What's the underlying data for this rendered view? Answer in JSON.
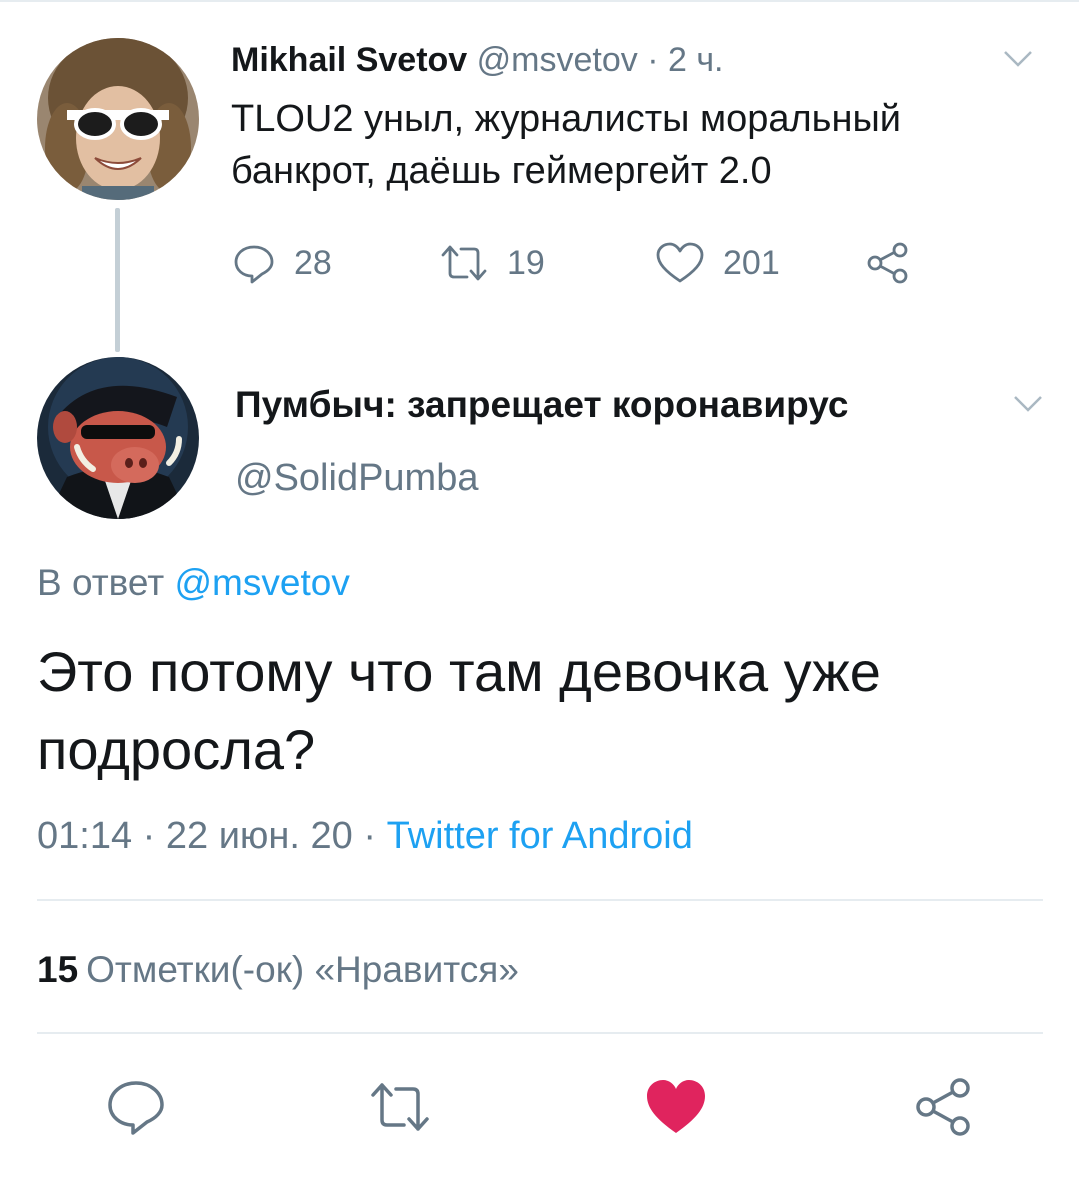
{
  "parent_tweet": {
    "name": "Mikhail Svetov",
    "handle": "@msvetov",
    "separator": " · ",
    "time": "2 ч.",
    "text": "TLOU2 уныл, журналисты моральный банкрот, даёшь  геймергейт 2.0",
    "replies": "28",
    "retweets": "19",
    "likes": "201"
  },
  "main_tweet": {
    "name": "Пумбыч: запрещает коронавирус",
    "handle": "@SolidPumba",
    "reply_prefix": "В ответ ",
    "reply_to": "@msvetov",
    "text": "Это потому что там девочка уже подросла?",
    "time": "01:14",
    "sep1": " · ",
    "date": "22 июн. 20",
    "sep2": " · ",
    "client": "Twitter for Android",
    "likes_count": "15",
    "likes_label": "Отметки(-ок) «Нравится»",
    "liked": true
  },
  "colors": {
    "text": "#14171a",
    "secondary": "#657786",
    "link": "#1da1f2",
    "like_active": "#e0245e",
    "divider": "#e6ecf0"
  },
  "icons": [
    "reply-icon",
    "retweet-icon",
    "like-icon",
    "share-icon",
    "chevron-down-icon"
  ]
}
